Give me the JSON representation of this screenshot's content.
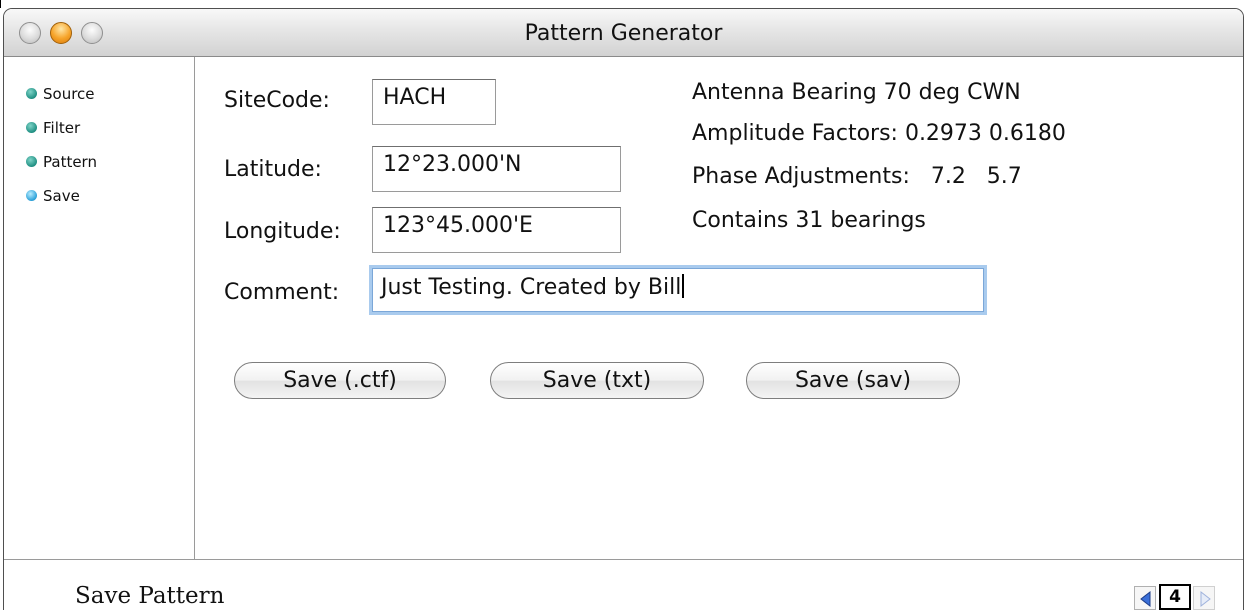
{
  "window": {
    "title": "Pattern Generator"
  },
  "sidebar": {
    "steps": [
      {
        "label": "Source"
      },
      {
        "label": "Filter"
      },
      {
        "label": "Pattern"
      },
      {
        "label": "Save"
      }
    ]
  },
  "form": {
    "sitecode": {
      "label": "SiteCode:",
      "value": "HACH"
    },
    "latitude": {
      "label": "Latitude:",
      "value": "12°23.000'N"
    },
    "longitude": {
      "label": "Longitude:",
      "value": "123°45.000'E"
    },
    "comment": {
      "label": "Comment:",
      "value": "Just Testing. Created by Bill"
    }
  },
  "info": {
    "bearing": "Antenna Bearing 70 deg CWN",
    "amplitude": "Amplitude Factors: 0.2973 0.6180",
    "phase": "Phase Adjustments:   7.2   5.7",
    "count": "Contains 31 bearings"
  },
  "buttons": {
    "save_ctf": "Save  (.ctf)",
    "save_txt": "Save  (txt)",
    "save_sav": "Save  (sav)"
  },
  "status": {
    "text": "Save Pattern"
  },
  "pager": {
    "page": "4"
  },
  "colors": {
    "step_dot": "#1f8f82",
    "current_step_dot": "#2aa0d8",
    "focus_ring": "#a9cbee"
  }
}
